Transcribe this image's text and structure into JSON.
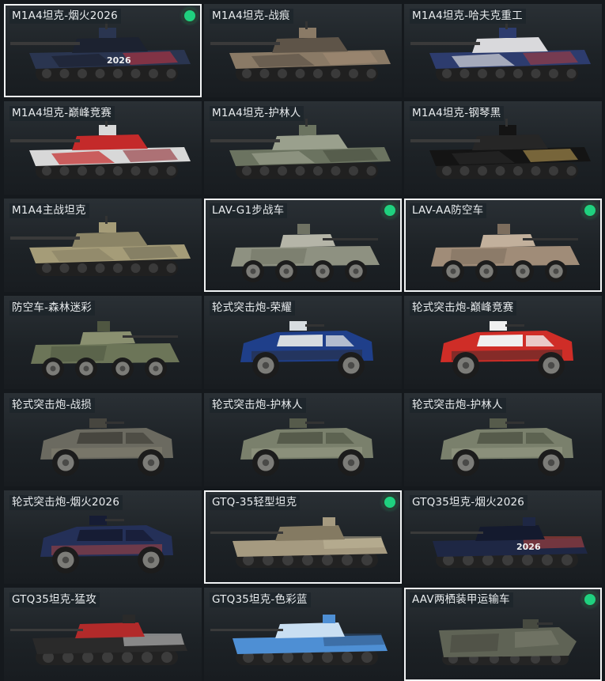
{
  "vehicles": [
    {
      "name": "M1A4坦克-烟火2026",
      "selected": true,
      "owned": true,
      "kind": "tank",
      "colors": [
        "#2a3550",
        "#1c2230",
        "#c8323c"
      ],
      "decal": "2026"
    },
    {
      "name": "M1A4坦克-战痕",
      "selected": false,
      "owned": false,
      "kind": "tank",
      "colors": [
        "#8a7a66",
        "#5e5448",
        "#a48c74"
      ]
    },
    {
      "name": "M1A4坦克-哈夫克重工",
      "selected": false,
      "owned": false,
      "kind": "tank",
      "colors": [
        "#2d3c6e",
        "#d9d9dc",
        "#b23a3a"
      ]
    },
    {
      "name": "M1A4坦克-巅峰竞赛",
      "selected": false,
      "owned": false,
      "kind": "tank",
      "colors": [
        "#d8d8d8",
        "#c42a2a",
        "#8b1e24"
      ]
    },
    {
      "name": "M1A4坦克-护林人",
      "selected": false,
      "owned": false,
      "kind": "tank",
      "colors": [
        "#6b7360",
        "#9aa08d",
        "#454b3c"
      ]
    },
    {
      "name": "M1A4坦克-钢琴黑",
      "selected": false,
      "owned": false,
      "kind": "tank",
      "colors": [
        "#141414",
        "#262626",
        "#c9a85a"
      ]
    },
    {
      "name": "M1A4主战坦克",
      "selected": false,
      "owned": false,
      "kind": "tank",
      "colors": [
        "#a59c78",
        "#8b8466",
        "#6d6a55"
      ]
    },
    {
      "name": "LAV-G1步战车",
      "selected": true,
      "owned": true,
      "kind": "lav",
      "colors": [
        "#8e9181",
        "#6f7263",
        "#b5b5a8"
      ]
    },
    {
      "name": "LAV-AA防空车",
      "selected": true,
      "owned": true,
      "kind": "lav",
      "colors": [
        "#a08c78",
        "#7c6d5d",
        "#c2b09c"
      ]
    },
    {
      "name": "防空车-森林迷彩",
      "selected": false,
      "owned": false,
      "kind": "lav",
      "colors": [
        "#6c7558",
        "#4f5641",
        "#8a9070"
      ]
    },
    {
      "name": "轮式突击炮-荣耀",
      "selected": false,
      "owned": false,
      "kind": "armor",
      "colors": [
        "#1f3f8a",
        "#d7dce0",
        "#2a2a2a"
      ]
    },
    {
      "name": "轮式突击炮-巅峰竞赛",
      "selected": false,
      "owned": false,
      "kind": "armor",
      "colors": [
        "#cf2d27",
        "#f0f0f0",
        "#2a2a2a"
      ]
    },
    {
      "name": "轮式突击炮-战损",
      "selected": false,
      "owned": false,
      "kind": "armor",
      "colors": [
        "#6b6a60",
        "#47463f",
        "#8a8476"
      ]
    },
    {
      "name": "轮式突击炮-护林人",
      "selected": false,
      "owned": false,
      "kind": "armor",
      "colors": [
        "#7a806c",
        "#565b4b",
        "#a0a48e"
      ]
    },
    {
      "name": "轮式突击炮-护林人",
      "selected": false,
      "owned": false,
      "kind": "armor",
      "colors": [
        "#7a806c",
        "#565b4b",
        "#a0a48e"
      ]
    },
    {
      "name": "轮式突击炮-烟火2026",
      "selected": false,
      "owned": false,
      "kind": "armor",
      "colors": [
        "#243058",
        "#161c34",
        "#c7463a"
      ]
    },
    {
      "name": "GTQ-35轻型坦克",
      "selected": true,
      "owned": true,
      "kind": "light",
      "colors": [
        "#a59a80",
        "#847a62",
        "#c4b99c"
      ]
    },
    {
      "name": "GTQ35坦克-烟火2026",
      "selected": false,
      "owned": false,
      "kind": "light",
      "colors": [
        "#1e2744",
        "#141a2e",
        "#c7463a"
      ],
      "decal": "2026"
    },
    {
      "name": "GTQ35坦克-猛攻",
      "selected": false,
      "owned": false,
      "kind": "light",
      "colors": [
        "#2a2a2a",
        "#b22a2a",
        "#e6e6e6"
      ]
    },
    {
      "name": "GTQ35坦克-色彩蓝",
      "selected": false,
      "owned": false,
      "kind": "light",
      "colors": [
        "#4e8fd4",
        "#c9dff2",
        "#2b4f7a"
      ]
    },
    {
      "name": "AAV两栖装甲运输车",
      "selected": true,
      "owned": true,
      "kind": "aav",
      "colors": [
        "#5f6355",
        "#474a40",
        "#7a7d6c"
      ]
    }
  ]
}
